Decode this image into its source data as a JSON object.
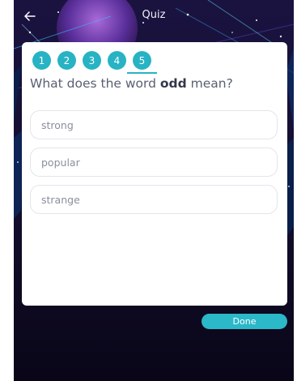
{
  "header": {
    "title": "Quiz",
    "back_icon": "arrow-left-icon"
  },
  "steps": [
    "1",
    "2",
    "3",
    "4",
    "5"
  ],
  "active_step": 5,
  "question": {
    "prefix": "What does the word ",
    "word": "odd",
    "suffix": " mean?"
  },
  "options": [
    "strong",
    "popular",
    "strange"
  ],
  "done_label": "Done",
  "colors": {
    "accent": "#27b3c4",
    "background": "#0e0a1f",
    "card": "#ffffff"
  }
}
